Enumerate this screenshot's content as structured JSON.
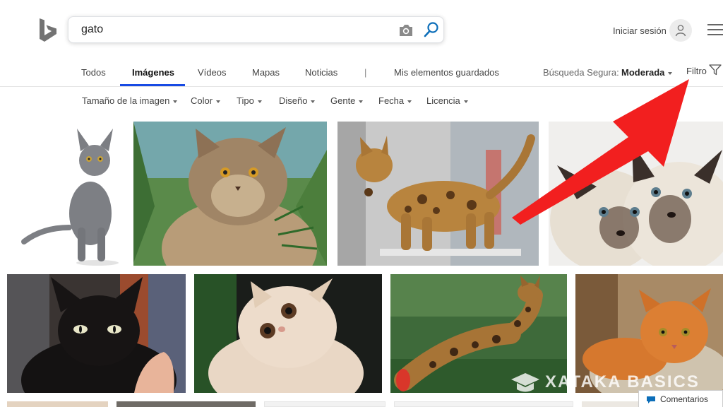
{
  "search": {
    "query": "gato"
  },
  "account": {
    "signin_label": "Iniciar sesión"
  },
  "nav": {
    "tabs": [
      {
        "label": "Todos"
      },
      {
        "label": "Imágenes",
        "active": true
      },
      {
        "label": "Vídeos"
      },
      {
        "label": "Mapas"
      },
      {
        "label": "Noticias"
      },
      {
        "label": "|"
      },
      {
        "label": "Mis elementos guardados"
      }
    ],
    "safe_search_label": "Búsqueda Segura:",
    "safe_search_value": "Moderada",
    "filter_label": "Filtro"
  },
  "filters": [
    {
      "label": "Tamaño de la imagen"
    },
    {
      "label": "Color"
    },
    {
      "label": "Tipo"
    },
    {
      "label": "Diseño"
    },
    {
      "label": "Gente"
    },
    {
      "label": "Fecha"
    },
    {
      "label": "Licencia"
    }
  ],
  "watermark": "XATAKA BASICS",
  "feedback_label": "Comentarios",
  "colors": {
    "accent": "#174ae4",
    "annotation_arrow": "#f21f1f",
    "search_blue": "#0c6eb9"
  }
}
